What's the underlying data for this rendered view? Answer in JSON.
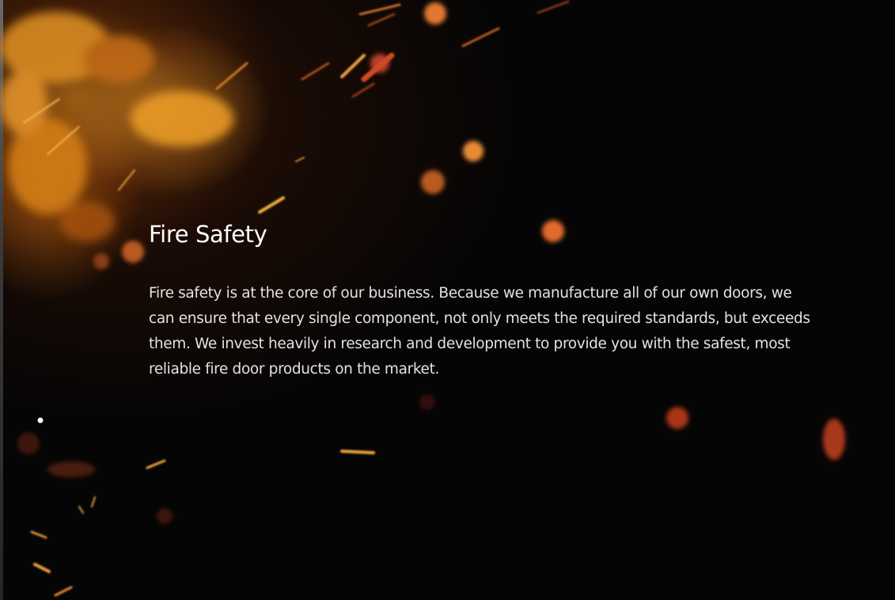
{
  "section": {
    "title": "Fire Safety",
    "body": "Fire safety is at the core of our business. Because we manufacture all of our own doors, we can ensure that every single component, not only meets the required standards, but exceeds them. We invest heavily in research and development to provide you with the safest, most reliable fire door products on the market."
  },
  "background": {
    "image": "sparks-on-black",
    "base_color": "#060505",
    "flame_color": "#e68c1e",
    "spark_color": "#f5a030"
  }
}
